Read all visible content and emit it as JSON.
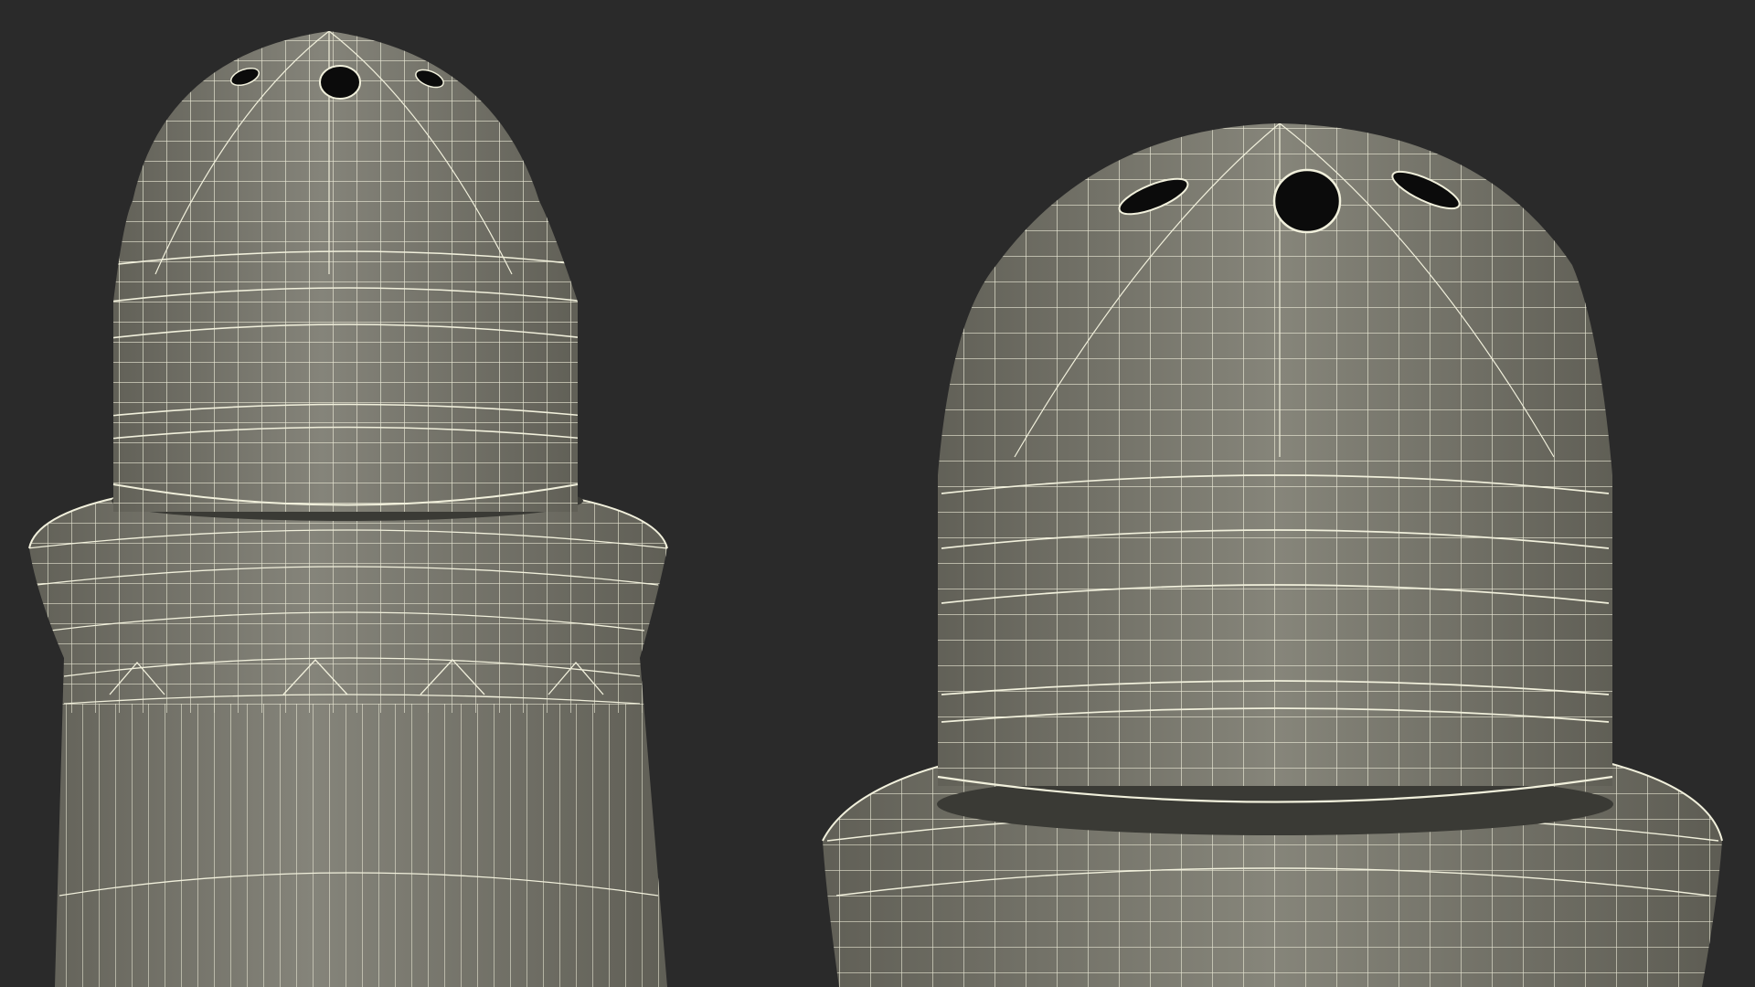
{
  "colors": {
    "background": "#2a2a2a",
    "surface": "#7a796e",
    "surface_light": "#8a897d",
    "surface_dark": "#5e5d54",
    "wire": "#f1f0dc",
    "hole": "#0b0b0b"
  },
  "objects": [
    {
      "name": "salt-shaker-left",
      "view": "medium-shot"
    },
    {
      "name": "salt-shaker-right",
      "view": "close-up"
    }
  ]
}
